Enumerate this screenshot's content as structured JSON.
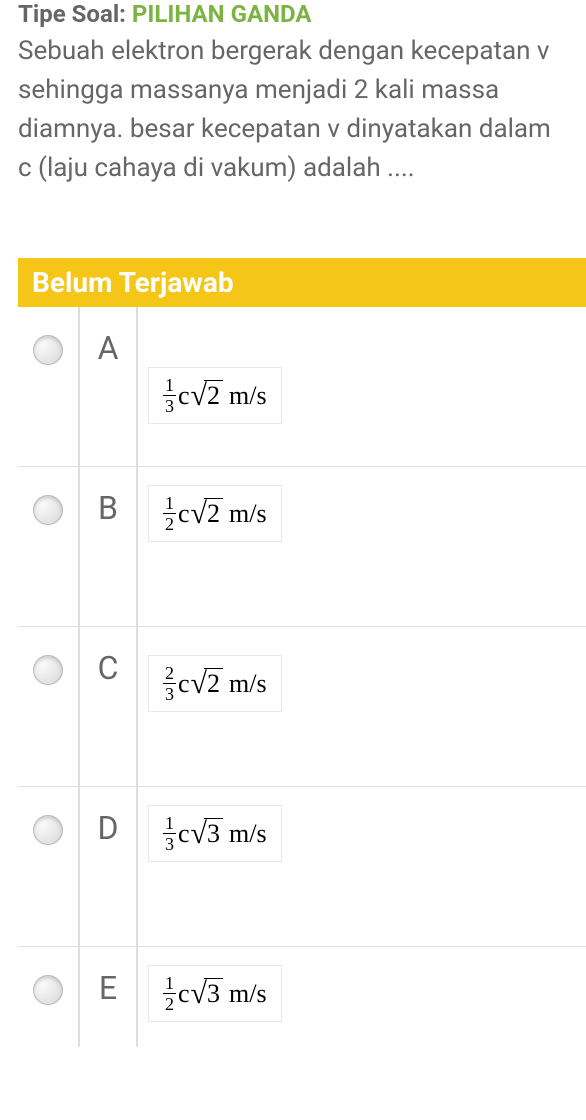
{
  "header": {
    "tipe_label": "Tipe Soal: ",
    "tipe_value": "PILIHAN GANDA"
  },
  "question": "Sebuah elektron bergerak dengan kecepatan v sehingga massanya menjadi 2 kali massa diamnya. besar kecepatan v dinyatakan dalam c (laju cahaya di vakum) adalah ....",
  "status": "Belum Terjawab",
  "options": [
    {
      "letter": "A",
      "numerator": "1",
      "denominator": "3",
      "radicand": "2",
      "unit": "m/s"
    },
    {
      "letter": "B",
      "numerator": "1",
      "denominator": "2",
      "radicand": "2",
      "unit": "m/s"
    },
    {
      "letter": "C",
      "numerator": "2",
      "denominator": "3",
      "radicand": "2",
      "unit": "m/s"
    },
    {
      "letter": "D",
      "numerator": "1",
      "denominator": "3",
      "radicand": "3",
      "unit": "m/s"
    },
    {
      "letter": "E",
      "numerator": "1",
      "denominator": "2",
      "radicand": "3",
      "unit": "m/s"
    }
  ],
  "coef": "c"
}
